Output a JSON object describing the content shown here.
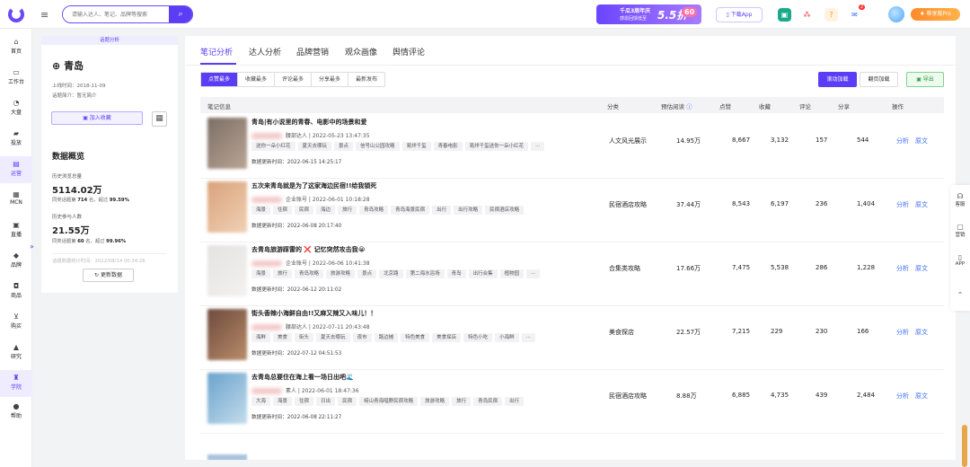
{
  "header": {
    "search_placeholder": "请输入达人、笔记、品牌等搜索",
    "banner_line1": "千瓜3周年庆",
    "banner_line2": "感恩回馈低至",
    "banner_discount": "5.5折",
    "banner_badge": "60",
    "download": "下载App",
    "notif_count": "2",
    "vip": "尊享版Pro"
  },
  "sidebar": {
    "items": [
      {
        "label": "首页",
        "icon": "home-icon"
      },
      {
        "label": "工作台",
        "icon": "monitor-icon"
      },
      {
        "label": "大盘",
        "icon": "pie-icon"
      },
      {
        "label": "投放",
        "icon": "folder-icon"
      },
      {
        "label": "运营",
        "icon": "chart-icon"
      },
      {
        "label": "MCN",
        "icon": "doc-icon"
      },
      {
        "label": "直播",
        "icon": "live-icon"
      },
      {
        "label": "品牌",
        "icon": "tag-icon"
      },
      {
        "label": "商品",
        "icon": "bag-icon"
      },
      {
        "label": "购买",
        "icon": "cart-icon"
      },
      {
        "label": "研究",
        "icon": "flask-icon"
      },
      {
        "label": "学院",
        "icon": "graduation-icon"
      },
      {
        "label": "帮助",
        "icon": "help-icon"
      }
    ]
  },
  "left": {
    "header": "话题分析",
    "title": "青岛",
    "online": "上线时间：2018-11-09",
    "intro": "话题简介：暂无简介",
    "fav": "加入收藏",
    "overview": "数据概览",
    "views_label": "历史浏览总量",
    "views": "5114.02万",
    "views_rank_pre": "同类话题第",
    "views_rank": "714",
    "views_rank_mid": "名，超过",
    "views_pct": "99.59%",
    "people_label": "历史参与人数",
    "people": "21.55万",
    "people_rank_pre": "同类话题第",
    "people_rank": "60",
    "people_rank_mid": "名，超过",
    "people_pct": "99.96%",
    "stat_time": "话题数据统计时间：2022/08/14 00:34:26",
    "update": "更新数据"
  },
  "tabs": [
    "笔记分析",
    "达人分析",
    "品牌营销",
    "观众画像",
    "舆情评论"
  ],
  "sorts": [
    "点赞最多",
    "收藏最多",
    "评论最多",
    "分享最多",
    "最新发布"
  ],
  "load": {
    "scroll": "滚动加载",
    "page": "翻页加载",
    "export": "导出"
  },
  "columns": {
    "info": "笔记信息",
    "cat": "分类",
    "read": "预估阅读",
    "like": "点赞",
    "fav": "收藏",
    "comment": "评论",
    "share": "分享",
    "op": "操作"
  },
  "rows": [
    {
      "title": "青岛|有小说里的青春、电影中的场景和爱",
      "author": "腰部达人 | 2022-05-23 13:47:35",
      "tags": [
        "送你一朵小红花",
        "夏天去哪玩",
        "景点",
        "信号山公园攻略",
        "易烊千玺",
        "青春电影",
        "易烊千玺送你一朵小红花",
        "···"
      ],
      "updated": "数据更新时间：2022-06-15 14:25:17",
      "cat": "人文风光展示",
      "read": "14.95万",
      "like": "8,667",
      "fav": "3,132",
      "comment": "157",
      "share": "544",
      "c1": "#7d6f66",
      "c2": "#b9a593"
    },
    {
      "title": "五次来青岛就是为了这家海边民宿!!给我锁死",
      "author": "企业账号 | 2022-06-01 10:18:28",
      "tags": [
        "海景",
        "住宿",
        "民宿",
        "海边",
        "旅行",
        "青岛攻略",
        "青岛海景民宿",
        "出行",
        "出行攻略",
        "民宿酒店攻略"
      ],
      "updated": "数据更新时间：2022-06-08 20:17:40",
      "cat": "民宿酒店攻略",
      "read": "37.44万",
      "like": "8,543",
      "fav": "6,197",
      "comment": "236",
      "share": "1,404",
      "c1": "#d9a27a",
      "c2": "#f0d1b5"
    },
    {
      "title": "去青岛旅游踩雷的 ❌ 记忆突然攻击我😭",
      "author": "企业账号 | 2022-06-06 10:41:38",
      "tags": [
        "海景",
        "旅行",
        "青岛攻略",
        "旅游攻略",
        "景点",
        "北京路",
        "第二海水浴场",
        "青岛",
        "出行合集",
        "植物园",
        "···"
      ],
      "updated": "数据更新时间：2022-06-12 20:11:02",
      "cat": "合集类攻略",
      "read": "17.66万",
      "like": "7,475",
      "fav": "5,538",
      "comment": "286",
      "share": "1,228",
      "c1": "#e4e2e2",
      "c2": "#f4f2f0"
    },
    {
      "title": "街头香辣小海鲜自由!!又麻又辣又入味儿！！",
      "author": "腰部达人 | 2022-07-11 20:43:48",
      "tags": [
        "海鲜",
        "美食",
        "街头",
        "夏天去哪玩",
        "夜市",
        "路边摊",
        "特色美食",
        "美食探店",
        "特色小吃",
        "小海鲜",
        "···"
      ],
      "updated": "数据更新时间：2022-07-12 04:51:53",
      "cat": "美食探店",
      "read": "22.57万",
      "like": "7,215",
      "fav": "229",
      "comment": "230",
      "share": "166",
      "c1": "#6e4a3d",
      "c2": "#b98d6a"
    },
    {
      "title": "去青岛总要住在海上看一场日出吧🌊",
      "author": "素人 | 2022-06-01 18:47:36",
      "tags": [
        "大海",
        "海景",
        "住宿",
        "日出",
        "民宿",
        "崂山青海唱野民宿攻略",
        "旅游攻略",
        "旅行",
        "青岛民宿",
        "出行"
      ],
      "updated": "数据更新时间：2022-06-08 22:11:27",
      "cat": "民宿酒店攻略",
      "read": "8.88万",
      "like": "6,885",
      "fav": "4,735",
      "comment": "439",
      "share": "2,484",
      "c1": "#6aa3cc",
      "c2": "#c4dcec"
    }
  ],
  "op": {
    "analyze": "分析",
    "origin": "原文"
  },
  "rside": [
    {
      "label": "客服",
      "icon": "headset-icon"
    },
    {
      "label": "营销",
      "icon": "chat-icon"
    },
    {
      "label": "APP",
      "icon": "phone-icon"
    }
  ]
}
